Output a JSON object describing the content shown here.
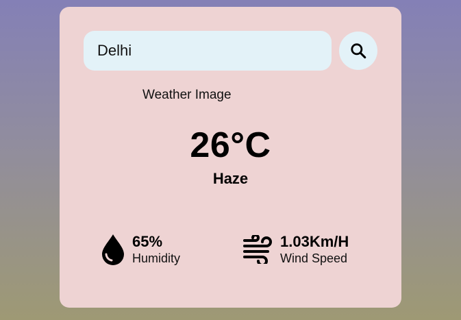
{
  "search": {
    "value": "Delhi",
    "icon": "search-icon"
  },
  "weather": {
    "image_alt": "Weather Image",
    "temperature": "26°C",
    "condition": "Haze"
  },
  "stats": {
    "humidity": {
      "value": "65%",
      "label": "Humidity",
      "icon": "water-drop-icon"
    },
    "wind": {
      "value": "1.03Km/H",
      "label": "Wind Speed",
      "icon": "wind-icon"
    }
  },
  "colors": {
    "card_background": "#eed3d3",
    "input_background": "#e3f2f8",
    "gradient_top": "#8480b6",
    "gradient_bottom": "#9e9974"
  }
}
